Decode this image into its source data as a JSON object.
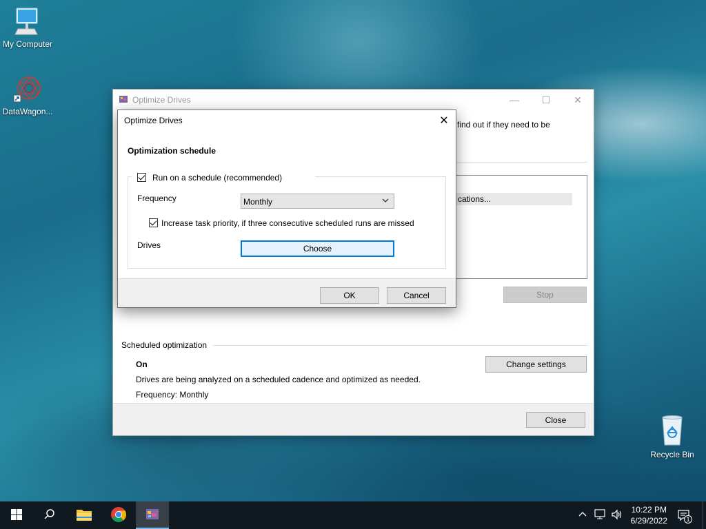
{
  "desktop": {
    "icons": [
      {
        "label": "My Computer"
      },
      {
        "label": "DataWagon..."
      },
      {
        "label": "Recycle Bin"
      }
    ]
  },
  "main_window": {
    "title": "Optimize Drives",
    "description_fragment": "find out if they need to be",
    "list_row_fragment": "cations...",
    "stop_label": "Stop",
    "scheduled_section": {
      "heading": "Scheduled optimization",
      "state": "On",
      "description": "Drives are being analyzed on a scheduled cadence and optimized as needed.",
      "frequency": "Frequency: Monthly",
      "change_settings_label": "Change settings"
    },
    "close_label": "Close"
  },
  "dialog": {
    "title": "Optimize Drives",
    "heading": "Optimization schedule",
    "run_on_schedule_label": "Run on a schedule (recommended)",
    "run_on_schedule_checked": true,
    "frequency_label": "Frequency",
    "frequency_value": "Monthly",
    "increase_priority_label": "Increase task priority, if three consecutive scheduled runs are missed",
    "increase_priority_checked": true,
    "drives_label": "Drives",
    "choose_label": "Choose",
    "ok_label": "OK",
    "cancel_label": "Cancel"
  },
  "taskbar": {
    "time": "10:22 PM",
    "date": "6/29/2022",
    "notification_count": "1",
    "accent": "#76b9ed"
  }
}
